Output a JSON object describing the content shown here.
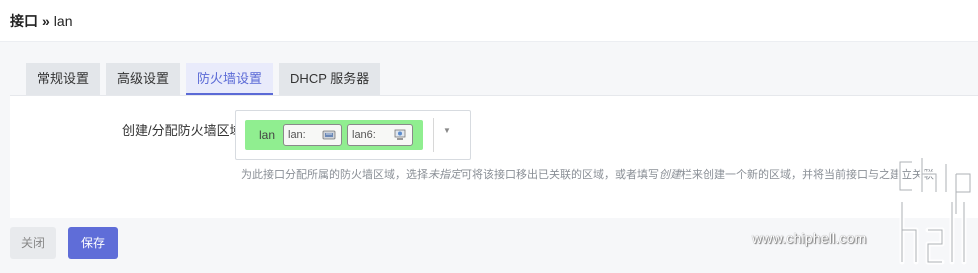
{
  "breadcrumb": {
    "parent": "接口",
    "separator": "»",
    "current": "lan"
  },
  "tabs": [
    {
      "label": "常规设置",
      "active": false
    },
    {
      "label": "高级设置",
      "active": false
    },
    {
      "label": "防火墙设置",
      "active": true
    },
    {
      "label": "DHCP 服务器",
      "active": false
    }
  ],
  "firewall_zone": {
    "label": "创建/分配防火墙区域",
    "selected_zone": "lan",
    "devices": [
      {
        "name": "lan:",
        "icon": "ethernet-port-icon"
      },
      {
        "name": "lan6:",
        "icon": "network-icon"
      }
    ],
    "help_prefix": "为此接口分配所属的防火墙区域，选择",
    "help_em1": "未指定",
    "help_mid": "可将该接口移出已关联的区域，或者填写",
    "help_em2": "创建",
    "help_suffix": "栏来创建一个新的区域，并将当前接口与之建立关联。"
  },
  "buttons": {
    "close_label": "关闭",
    "save_label": "保存"
  },
  "watermark": {
    "url": "www.chiphell.com",
    "logo_text": "chiphell"
  },
  "colors": {
    "accent": "#5f6dd8",
    "zone_color": "#90ee90"
  }
}
